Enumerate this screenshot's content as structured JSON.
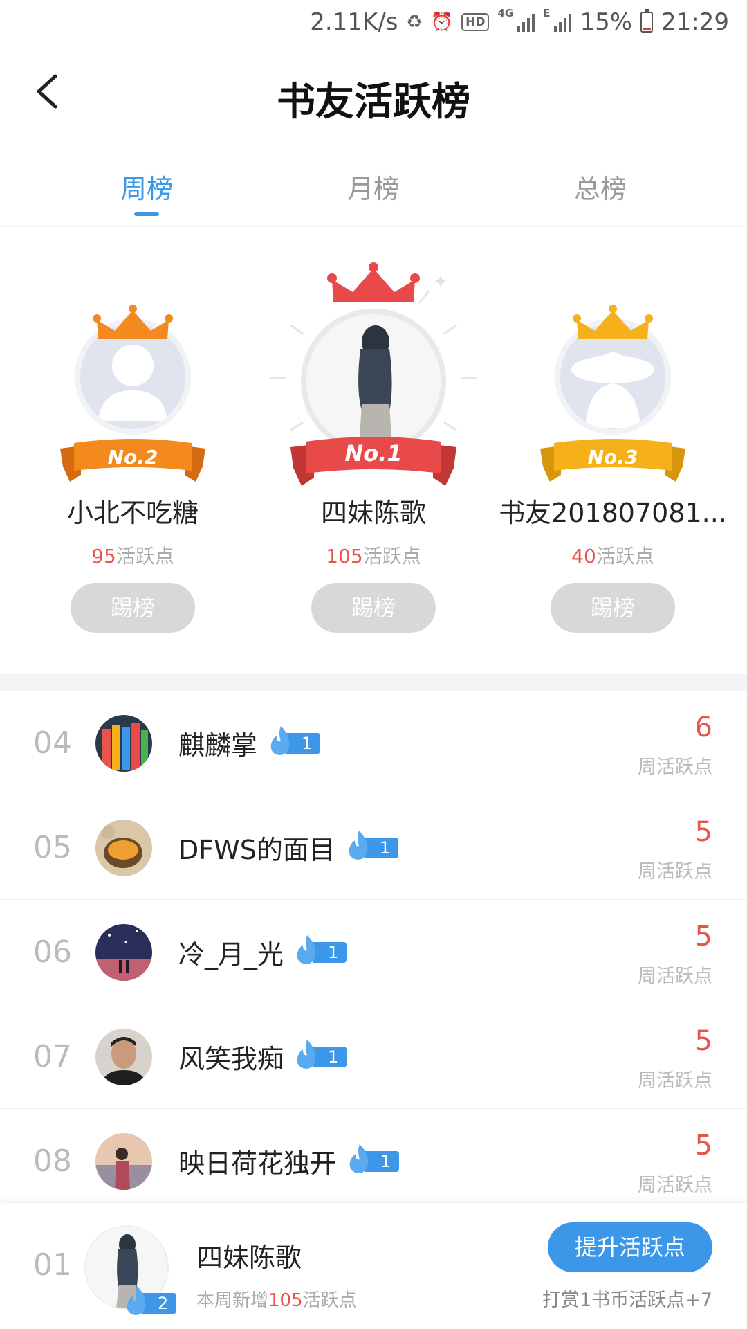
{
  "status_bar": {
    "net_speed": "2.11K/s",
    "network": "4G",
    "network2": "E",
    "battery_pct": "15%",
    "battery_level": 0.15,
    "time": "21:29"
  },
  "header": {
    "title": "书友活跃榜"
  },
  "tabs": [
    {
      "label": "周榜",
      "active": true
    },
    {
      "label": "月榜",
      "active": false
    },
    {
      "label": "总榜",
      "active": false
    }
  ],
  "podium": {
    "first": {
      "badge": "No.1",
      "name": "四妹陈歌",
      "points": "105",
      "points_unit": "活跃点",
      "button": "踢榜"
    },
    "second": {
      "badge": "No.2",
      "name": "小北不吃糖",
      "points": "95",
      "points_unit": "活跃点",
      "button": "踢榜"
    },
    "third": {
      "badge": "No.3",
      "name": "书友201807081...",
      "points": "40",
      "points_unit": "活跃点",
      "button": "踢榜"
    }
  },
  "list": [
    {
      "rank": "04",
      "name": "麒麟掌",
      "level": "1",
      "score": "6",
      "score_label": "周活跃点"
    },
    {
      "rank": "05",
      "name": "DFWS的面目",
      "level": "1",
      "score": "5",
      "score_label": "周活跃点"
    },
    {
      "rank": "06",
      "name": "冷_月_光",
      "level": "1",
      "score": "5",
      "score_label": "周活跃点"
    },
    {
      "rank": "07",
      "name": "风笑我痴",
      "level": "1",
      "score": "5",
      "score_label": "周活跃点"
    },
    {
      "rank": "08",
      "name": "映日荷花独开",
      "level": "1",
      "score": "5",
      "score_label": "周活跃点"
    }
  ],
  "my_rank": {
    "rank": "01",
    "name": "四妹陈歌",
    "level": "2",
    "sub_prefix": "本周新增",
    "sub_points": "105",
    "sub_suffix": "活跃点",
    "button": "提升活跃点",
    "note": "打赏1书币活跃点+7"
  },
  "colors": {
    "accent": "#3c97e8",
    "score_red": "#e8534a",
    "gold": "#f6b01a",
    "orange": "#f48a1e",
    "crimson": "#e84a4a"
  }
}
